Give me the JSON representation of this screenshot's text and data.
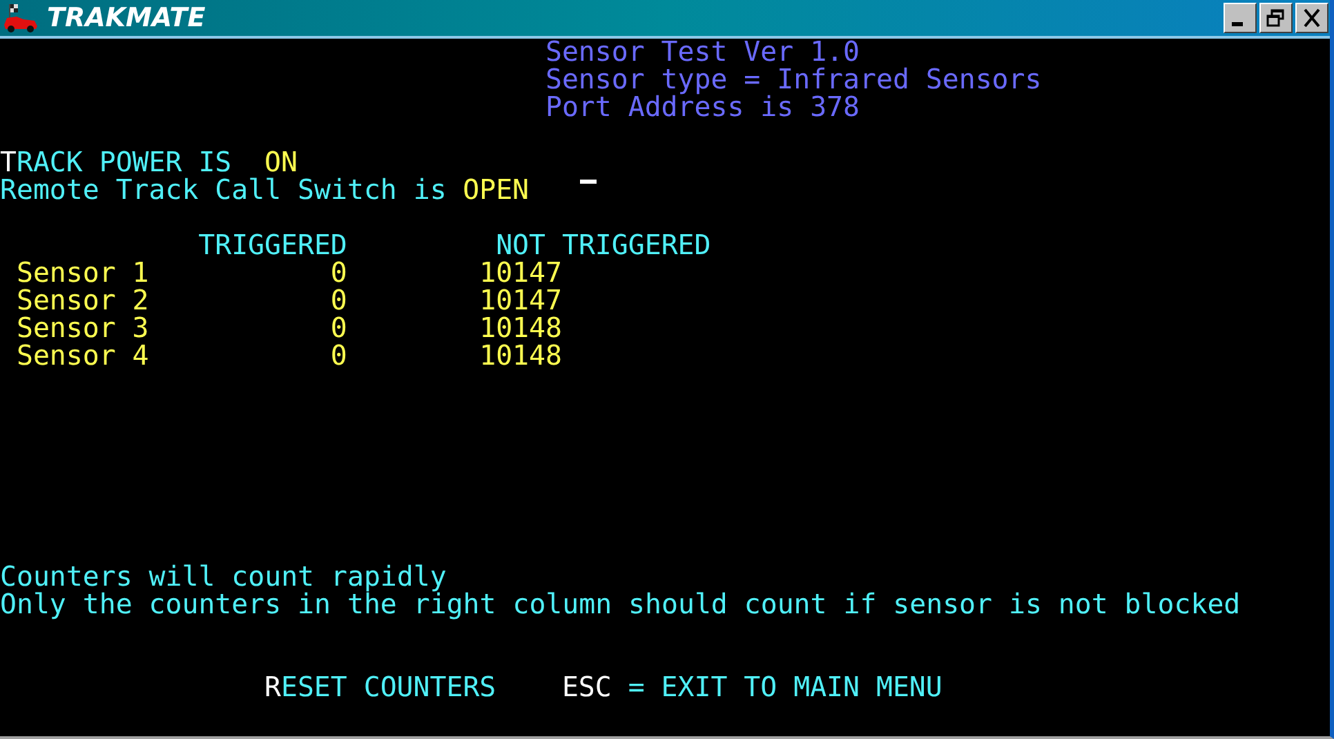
{
  "window": {
    "title": "TRAKMATE"
  },
  "header": [
    "Sensor Test Ver 1.0",
    "Sensor type = Infrared Sensors",
    "Port Address is 378"
  ],
  "track_power": {
    "key": "T",
    "label": "RACK POWER IS",
    "value": "ON"
  },
  "switch": {
    "label": "Remote Track Call Switch is",
    "value": "OPEN"
  },
  "columns": [
    "TRIGGERED",
    "NOT TRIGGERED"
  ],
  "sensors": [
    {
      "name": "Sensor 1",
      "triggered": "0",
      "not_triggered": "10147"
    },
    {
      "name": "Sensor 2",
      "triggered": "0",
      "not_triggered": "10147"
    },
    {
      "name": "Sensor 3",
      "triggered": "0",
      "not_triggered": "10148"
    },
    {
      "name": "Sensor 4",
      "triggered": "0",
      "not_triggered": "10148"
    }
  ],
  "notes": [
    "Counters will count rapidly",
    "Only the counters in the right column should count if sensor is not blocked"
  ],
  "commands": [
    {
      "key": "R",
      "label": "ESET COUNTERS"
    },
    {
      "key": "ESC",
      "label": "= EXIT TO MAIN MENU"
    }
  ]
}
